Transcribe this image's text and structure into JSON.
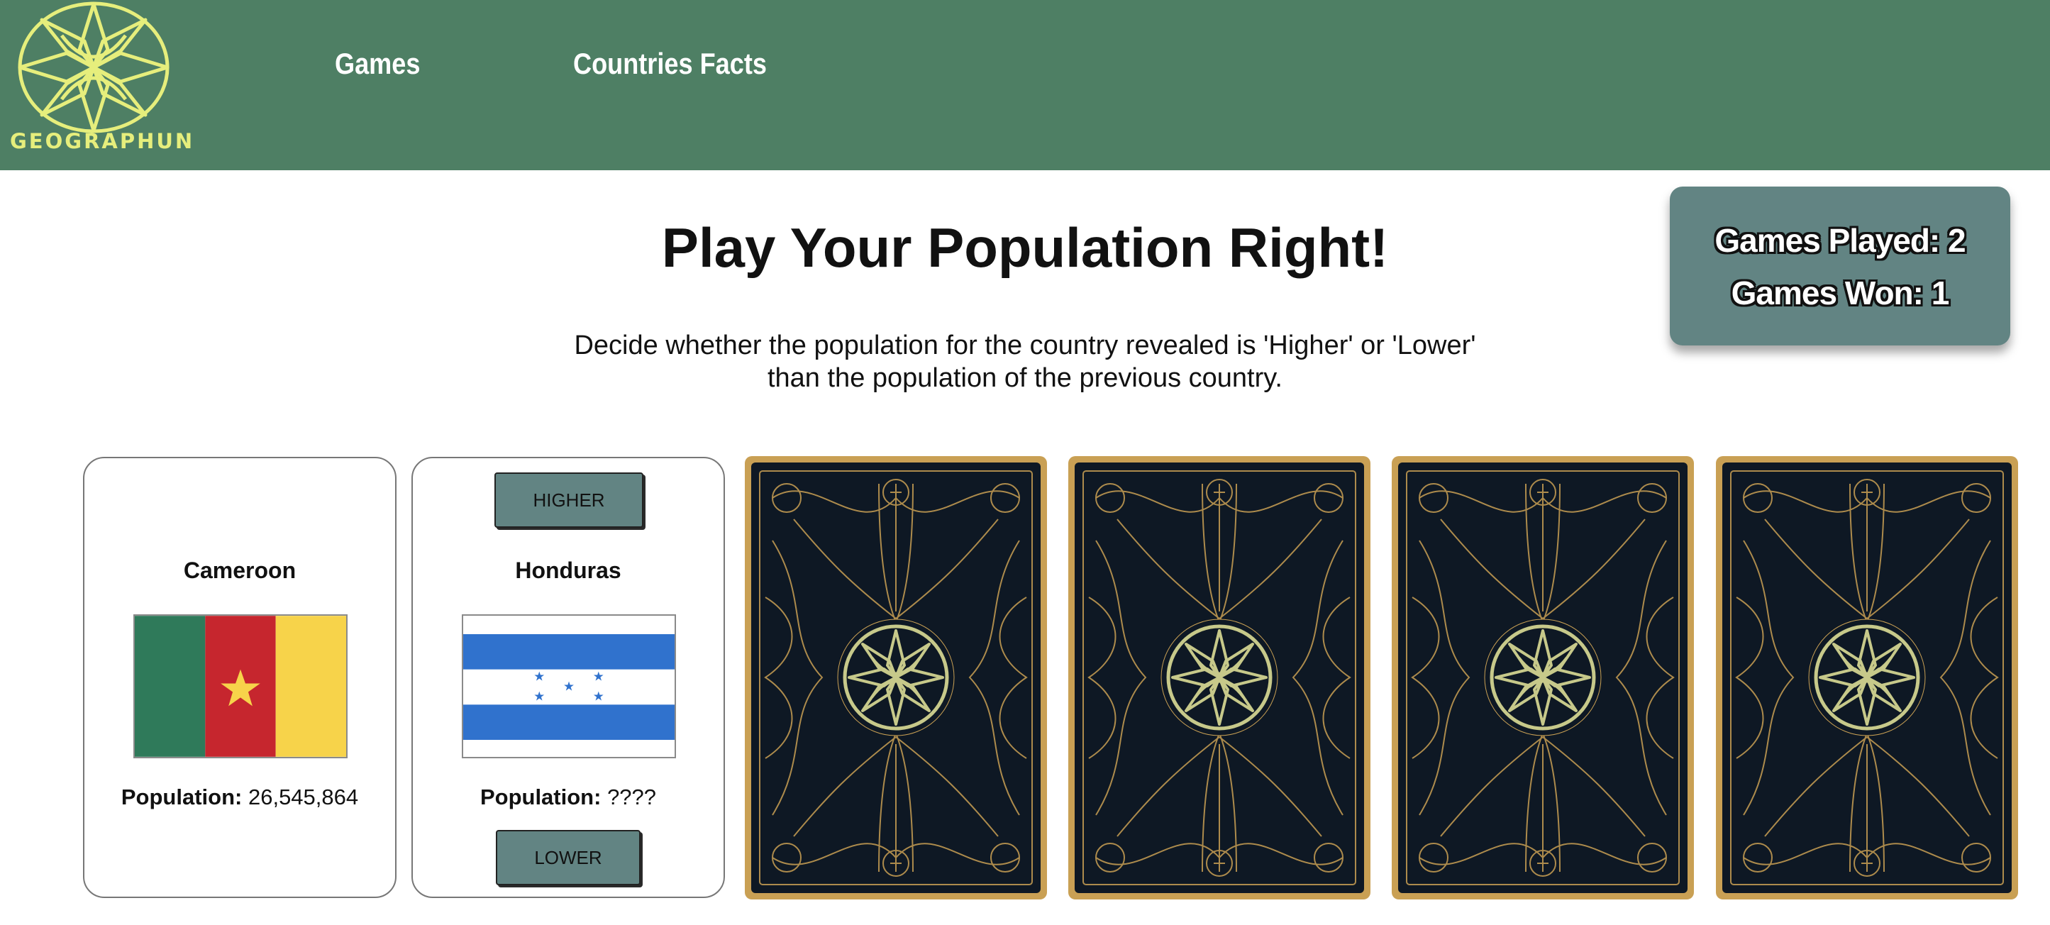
{
  "header": {
    "logo_text": "GEOGRAPHUN",
    "nav": {
      "games": "Games",
      "countries_facts": "Countries Facts"
    },
    "colors": {
      "bar": "#4e7f64",
      "logo": "#e6ee7c"
    }
  },
  "main": {
    "title": "Play Your Population Right!",
    "description": "Decide whether the population for the country revealed is 'Higher' or 'Lower' than the population of the previous country."
  },
  "stats": {
    "games_played": "Games Played: 2",
    "games_won": "Games Won: 1"
  },
  "cards": [
    {
      "country": "Cameroon",
      "population_label": "Population:",
      "population_value": "26,545,864",
      "flag": "cameroon-flag"
    },
    {
      "country": "Honduras",
      "population_label": "Population:",
      "population_value": "????",
      "flag": "honduras-flag",
      "higher_label": "HIGHER",
      "lower_label": "LOWER"
    }
  ],
  "face_down_cards": 4,
  "colors": {
    "button": "#628483",
    "card_back": "#0e1824",
    "card_gold": "#c9a054",
    "emblem": "#c7c98a"
  }
}
